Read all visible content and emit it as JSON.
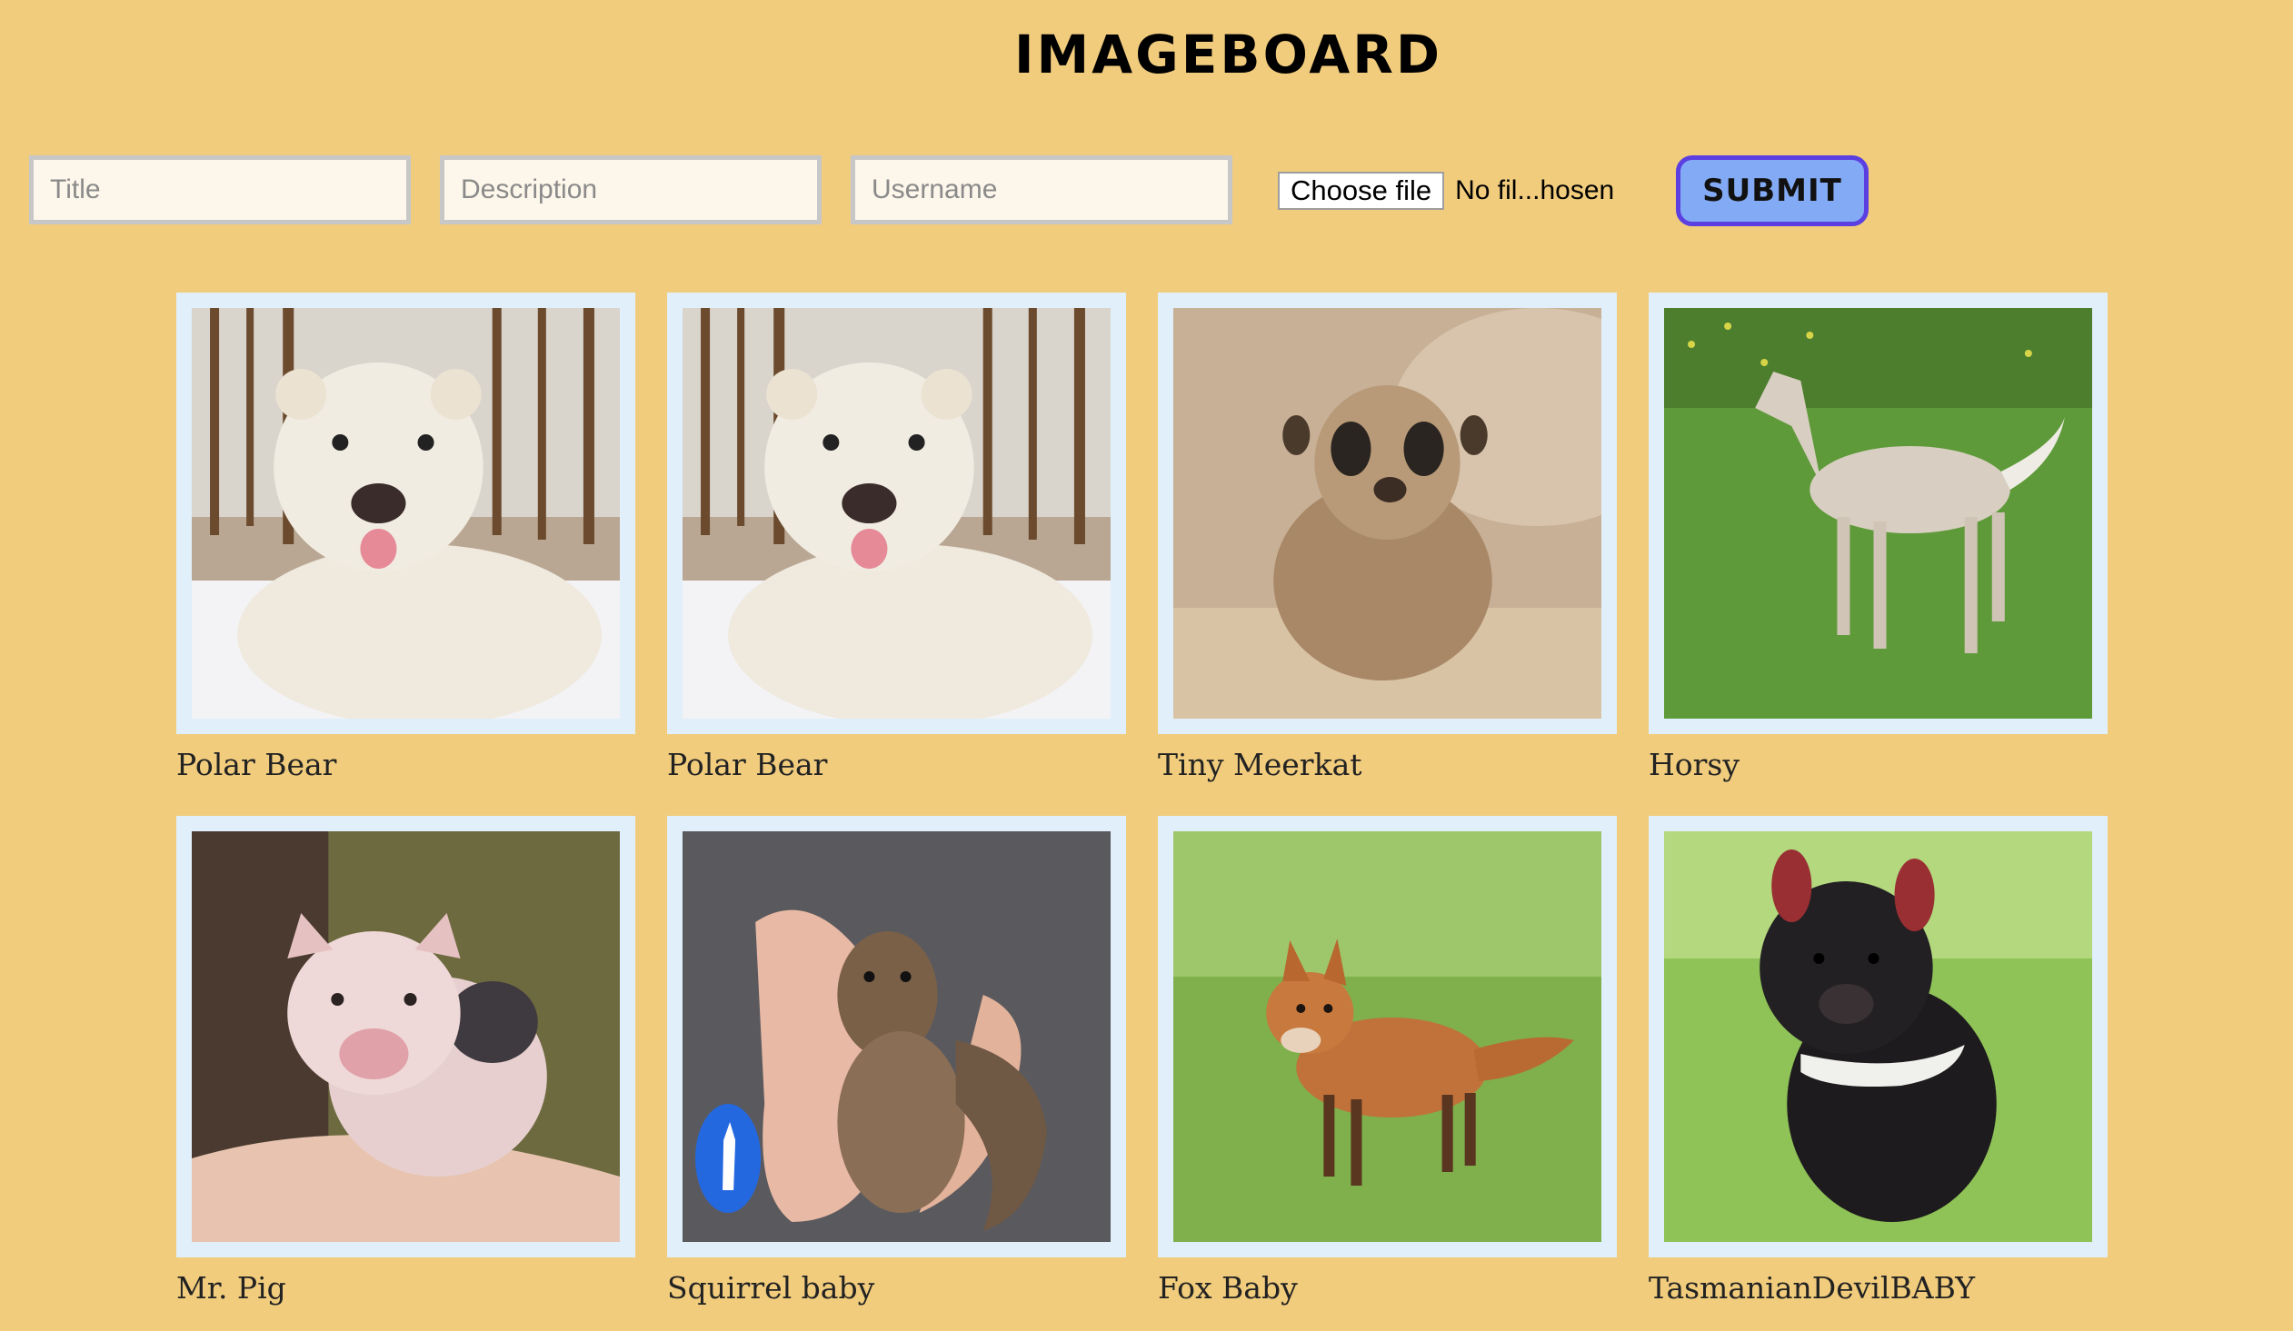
{
  "header": {
    "title": "IMAGEBOARD"
  },
  "form": {
    "title_placeholder": "Title",
    "description_placeholder": "Description",
    "username_placeholder": "Username",
    "choose_file_label": "Choose file",
    "file_status": "No fil...hosen",
    "submit_label": "SUBMIT"
  },
  "images": [
    {
      "title": "Polar Bear",
      "icon": "polar-bear-photo"
    },
    {
      "title": "Polar Bear",
      "icon": "polar-bear-photo"
    },
    {
      "title": "Tiny Meerkat",
      "icon": "meerkat-photo"
    },
    {
      "title": "Horsy",
      "icon": "foal-photo"
    },
    {
      "title": "Mr. Pig",
      "icon": "piglet-photo"
    },
    {
      "title": "Squirrel baby",
      "icon": "squirrel-photo"
    },
    {
      "title": "Fox Baby",
      "icon": "fox-cub-photo"
    },
    {
      "title": "TasmanianDevilBABY",
      "icon": "tasmanian-devil-photo"
    }
  ],
  "colors": {
    "background": "#f1cc7d",
    "submit_fill": "#83aaf4",
    "submit_border": "#5b3fe0",
    "card_frame": "#e0eff9"
  }
}
